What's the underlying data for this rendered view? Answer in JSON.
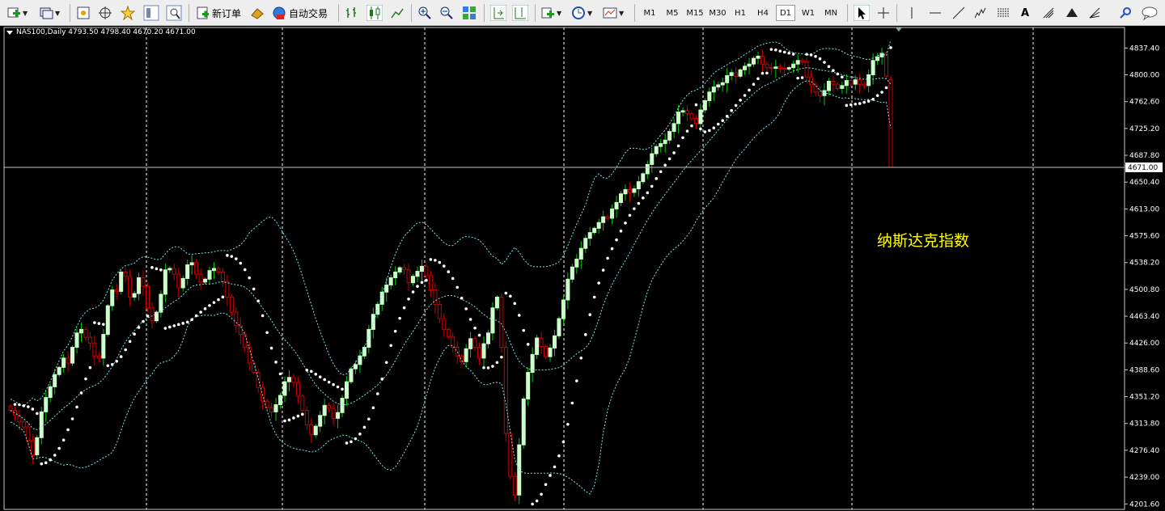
{
  "toolbar": {
    "new_order_label": "新订单",
    "auto_trading_label": "自动交易",
    "timeframes": [
      "M1",
      "M5",
      "M15",
      "M30",
      "H1",
      "H4",
      "D1",
      "W1",
      "MN"
    ],
    "active_timeframe": "D1",
    "tools": [
      "new-chart-icon",
      "profiles-icon",
      "market-watch-icon",
      "navigator-icon",
      "favorites-icon",
      "data-window-icon",
      "terminal-icon",
      "new-order-icon",
      "auto-trading-icon",
      "bar-chart-icon",
      "candlestick-icon",
      "line-chart-icon",
      "zoom-in-icon",
      "zoom-out-icon",
      "tile-windows-icon",
      "auto-scroll-icon",
      "chart-shift-icon",
      "indicators-icon",
      "periods-icon",
      "templates-icon",
      "cursor-icon",
      "crosshair-icon",
      "vertical-line-icon",
      "horizontal-line-icon",
      "trendline-icon",
      "equidistant-channel-icon",
      "fibonacci-icon",
      "text-icon",
      "text-label-icon",
      "arrow-icon",
      "fibo-fan-icon",
      "search-icon",
      "chat-icon"
    ]
  },
  "chart": {
    "title": "NAS100,Daily  4793.50 4798.40 4670.20 4671.00",
    "annotation": "纳斯达克指数",
    "current_price_label": "4671.00",
    "colors": {
      "background": "#000000",
      "bull_body": "#ccffcc",
      "bear": "#cc0000",
      "bull_wick": "#00cc00",
      "bands": "#7fe6e6",
      "sar": "#ffffff",
      "grid": "#ffffff",
      "axis_text": "#ffffff",
      "annotation": "#ffff00"
    }
  },
  "chart_data": {
    "type": "candlestick",
    "title": "NAS100,Daily",
    "ohlc_header": {
      "open": 4793.5,
      "high": 4798.4,
      "low": 4670.2,
      "close": 4671.0
    },
    "yticks": [
      4837.4,
      4800.0,
      4762.6,
      4725.2,
      4687.8,
      4650.4,
      4613.0,
      4575.6,
      4538.2,
      4500.8,
      4463.4,
      4426.0,
      4388.6,
      4351.2,
      4313.8,
      4276.4,
      4239.0,
      4201.6
    ],
    "ylim": [
      4194,
      4866
    ],
    "current_price": 4671.0,
    "grid": "vertical dashed",
    "indicators": [
      "Bollinger Bands",
      "Parabolic SAR"
    ],
    "closes": [
      4332,
      4325,
      4316,
      4309,
      4290,
      4270,
      4294,
      4330,
      4350,
      4365,
      4382,
      4392,
      4405,
      4398,
      4420,
      4440,
      4445,
      4434,
      4426,
      4408,
      4405,
      4438,
      4478,
      4500,
      4498,
      4525,
      4519,
      4490,
      4495,
      4517,
      4505,
      4475,
      4457,
      4469,
      4494,
      4528,
      4530,
      4522,
      4503,
      4516,
      4535,
      4538,
      4522,
      4511,
      4515,
      4527,
      4530,
      4525,
      4512,
      4490,
      4469,
      4450,
      4438,
      4420,
      4398,
      4385,
      4364,
      4345,
      4336,
      4330,
      4340,
      4353,
      4372,
      4378,
      4371,
      4352,
      4332,
      4312,
      4298,
      4310,
      4325,
      4339,
      4335,
      4321,
      4329,
      4349,
      4372,
      4390,
      4396,
      4408,
      4420,
      4445,
      4466,
      4480,
      4497,
      4507,
      4517,
      4525,
      4531,
      4528,
      4510,
      4519,
      4526,
      4533,
      4520,
      4500,
      4480,
      4460,
      4445,
      4435,
      4420,
      4408,
      4400,
      4418,
      4432,
      4420,
      4405,
      4425,
      4440,
      4475,
      4490,
      4420,
      4300,
      4240,
      4214,
      4284,
      4348,
      4385,
      4410,
      4433,
      4421,
      4407,
      4419,
      4436,
      4460,
      4486,
      4515,
      4532,
      4543,
      4558,
      4572,
      4580,
      4586,
      4594,
      4602,
      4600,
      4613,
      4622,
      4634,
      4640,
      4636,
      4641,
      4651,
      4662,
      4675,
      4690,
      4700,
      4704,
      4709,
      4721,
      4732,
      4748,
      4750,
      4746,
      4739,
      4732,
      4751,
      4764,
      4776,
      4783,
      4786,
      4789,
      4799,
      4803,
      4798,
      4807,
      4812,
      4815,
      4823,
      4826,
      4815,
      4810,
      4809,
      4811,
      4809,
      4808,
      4810,
      4815,
      4820,
      4818,
      4797,
      4786,
      4776,
      4771,
      4778,
      4791,
      4787,
      4781,
      4785,
      4792,
      4787,
      4793,
      4787,
      4785,
      4800,
      4820,
      4825,
      4830,
      4798,
      4671
    ],
    "description_note": ""
  }
}
